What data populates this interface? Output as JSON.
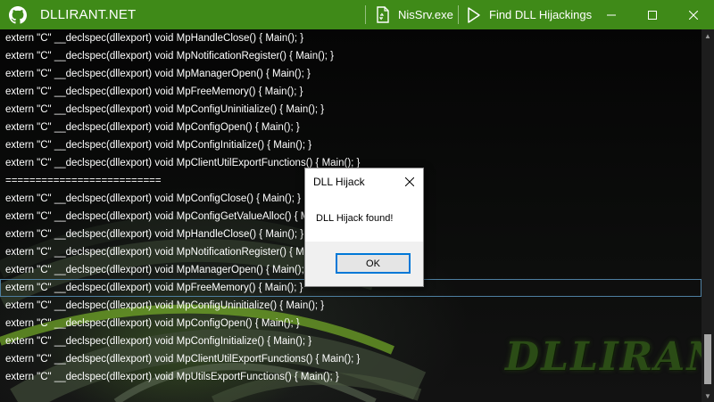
{
  "titlebar": {
    "title": "DLLIRANT.NET",
    "target_label": "NisSrv.exe",
    "find_label": "Find DLL Hijackings",
    "accent": "#3f8a18"
  },
  "output": {
    "lines": [
      "extern \"C\" __declspec(dllexport) void MpHandleClose() { Main(); }",
      "extern \"C\" __declspec(dllexport) void MpNotificationRegister() { Main(); }",
      "extern \"C\" __declspec(dllexport) void MpManagerOpen() { Main(); }",
      "extern \"C\" __declspec(dllexport) void MpFreeMemory() { Main(); }",
      "extern \"C\" __declspec(dllexport) void MpConfigUninitialize() { Main(); }",
      "extern \"C\" __declspec(dllexport) void MpConfigOpen() { Main(); }",
      "extern \"C\" __declspec(dllexport) void MpConfigInitialize() { Main(); }",
      "extern \"C\" __declspec(dllexport) void MpClientUtilExportFunctions() { Main(); }",
      "==========================",
      "extern \"C\" __declspec(dllexport) void MpConfigClose() { Main(); }",
      "extern \"C\" __declspec(dllexport) void MpConfigGetValueAlloc() { Main(); }",
      "extern \"C\" __declspec(dllexport) void MpHandleClose() { Main(); }",
      "extern \"C\" __declspec(dllexport) void MpNotificationRegister() { Main(); }",
      "extern \"C\" __declspec(dllexport) void MpManagerOpen() { Main(); }",
      "extern \"C\" __declspec(dllexport) void MpFreeMemory() { Main(); }",
      "extern \"C\" __declspec(dllexport) void MpConfigUninitialize() { Main(); }",
      "extern \"C\" __declspec(dllexport) void MpConfigOpen() { Main(); }",
      "extern \"C\" __declspec(dllexport) void MpConfigInitialize() { Main(); }",
      "extern \"C\" __declspec(dllexport) void MpClientUtilExportFunctions() { Main(); }",
      "extern \"C\" __declspec(dllexport) void MpUtilsExportFunctions() { Main(); }"
    ],
    "selected_index": 14
  },
  "branding": {
    "logo_text": "DLLIRANT"
  },
  "dialog": {
    "title": "DLL Hijack",
    "message": "DLL Hijack found!",
    "ok_label": "OK"
  }
}
